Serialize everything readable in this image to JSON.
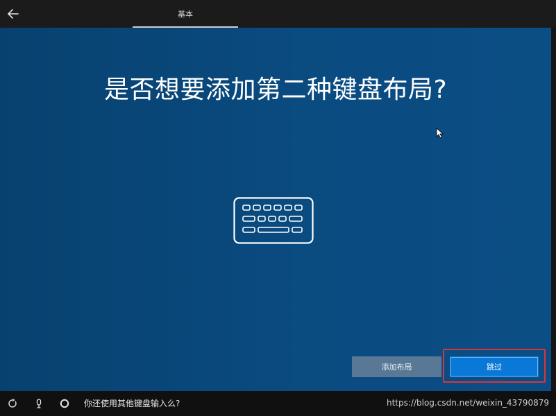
{
  "header": {
    "tab_basic": "基本"
  },
  "main": {
    "title": "是否想要添加第二种键盘布局?",
    "add_layout_label": "添加布局",
    "skip_label": "跳过"
  },
  "footer": {
    "prompt": "你还使用其他键盘输入么?"
  },
  "watermark": "https://blog.csdn.net/weixin_43790879",
  "icons": {
    "back": "back-arrow-icon",
    "keyboard": "keyboard-icon",
    "ease_of_access": "ease-of-access-icon",
    "microphone": "microphone-icon",
    "cortana": "cortana-circle-icon",
    "cursor": "mouse-cursor-icon"
  },
  "colors": {
    "background": "#0a4a7e",
    "topbar": "#1b1b1b",
    "bottombar": "#101010",
    "primary_button": "#0a78d6",
    "secondary_button": "#587896",
    "highlight": "#d8353a",
    "text": "#ffffff"
  }
}
